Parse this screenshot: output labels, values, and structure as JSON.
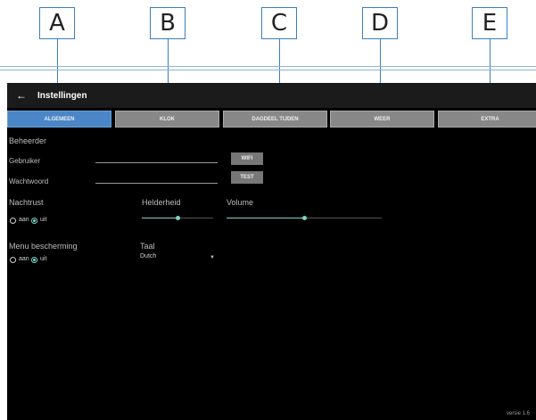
{
  "callouts": [
    "A",
    "B",
    "C",
    "D",
    "E"
  ],
  "appbar": {
    "back_icon": "arrow-left-icon",
    "title": "Instellingen"
  },
  "tabs": [
    {
      "label": "ALGEMEEN",
      "active": true
    },
    {
      "label": "KLOK",
      "active": false
    },
    {
      "label": "DAGDEEL TIJDEN",
      "active": false
    },
    {
      "label": "WEER",
      "active": false
    },
    {
      "label": "EXTRA",
      "active": false
    }
  ],
  "admin": {
    "heading": "Beheerder",
    "user_label": "Gebruiker",
    "user_value": "",
    "password_label": "Wachtwoord",
    "password_value": "",
    "wifi_button": "WIFI",
    "test_button": "TEST"
  },
  "night": {
    "heading": "Nachtrust",
    "on_label": "aan",
    "off_label": "uit",
    "selected": "uit"
  },
  "brightness": {
    "label": "Helderheid",
    "value_fraction": 0.5
  },
  "volume": {
    "label": "Volume",
    "value_fraction": 0.5
  },
  "menu_protection": {
    "heading": "Menu bescherming",
    "on_label": "aan",
    "off_label": "uit",
    "selected": "uit"
  },
  "language": {
    "label": "Taal",
    "selected": "Dutch"
  },
  "version": "versie 1.6",
  "colors": {
    "accent": "#7fd3c8",
    "tab_active": "#4a86c8",
    "tab_inactive": "#888888",
    "background": "#000000"
  }
}
